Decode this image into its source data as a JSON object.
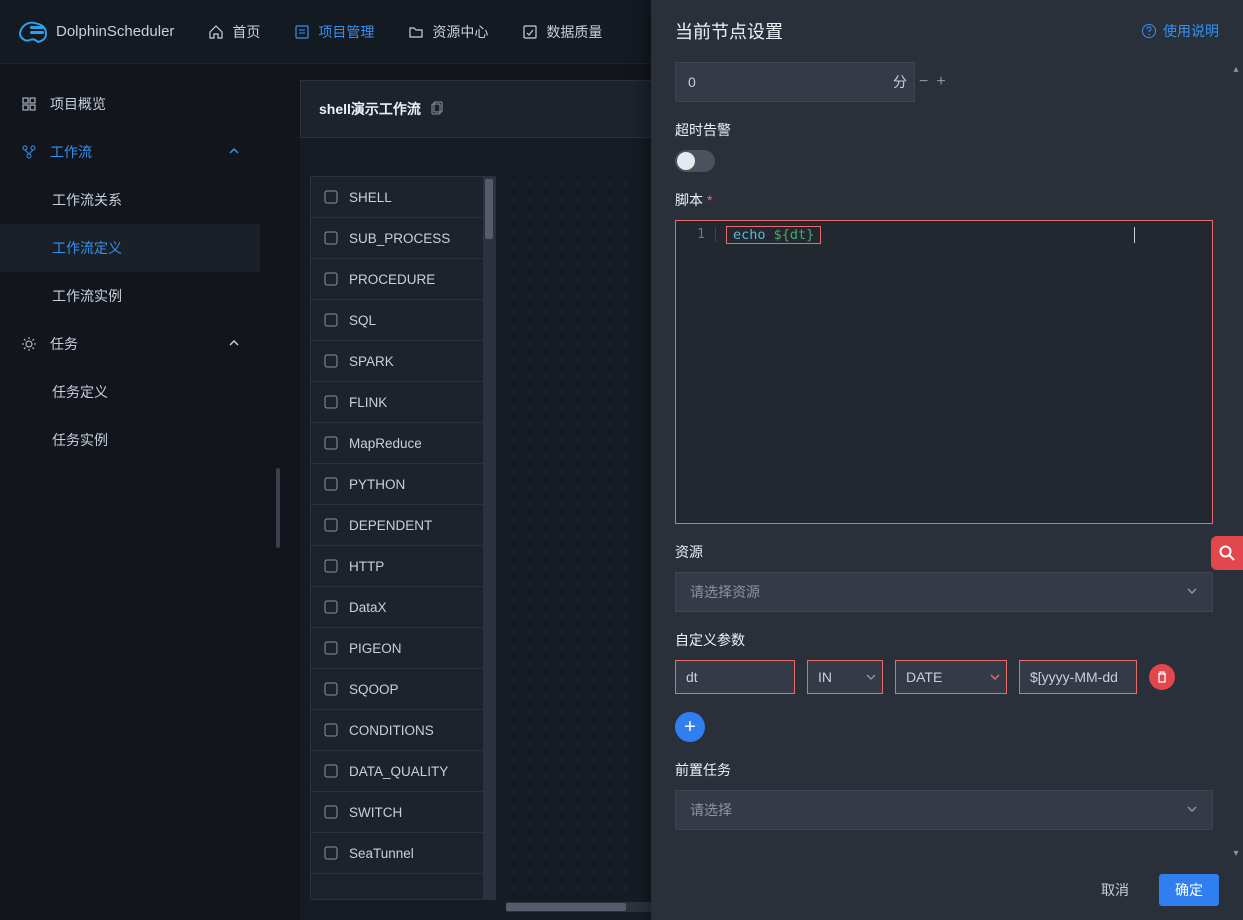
{
  "brand": "DolphinScheduler",
  "topnav": {
    "home": "首页",
    "project": "项目管理",
    "resource": "资源中心",
    "dataquality": "数据质量"
  },
  "sidebar": {
    "overview": "项目概览",
    "workflow": "工作流",
    "wf_relation": "工作流关系",
    "wf_definition": "工作流定义",
    "wf_instance": "工作流实例",
    "task": "任务",
    "task_definition": "任务定义",
    "task_instance": "任务实例"
  },
  "workflow": {
    "title": "shell演示工作流"
  },
  "taskTypes": [
    "SHELL",
    "SUB_PROCESS",
    "PROCEDURE",
    "SQL",
    "SPARK",
    "FLINK",
    "MapReduce",
    "PYTHON",
    "DEPENDENT",
    "HTTP",
    "DataX",
    "PIGEON",
    "SQOOP",
    "CONDITIONS",
    "DATA_QUALITY",
    "SWITCH",
    "SeaTunnel"
  ],
  "drawer": {
    "title": "当前节点设置",
    "help": "使用说明",
    "delay_value": "0",
    "delay_unit": "分",
    "timeout_label": "超时告警",
    "script_label": "脚本",
    "script_line_no": "1",
    "script_cmd": "echo",
    "script_var": "${dt}",
    "resource_label": "资源",
    "resource_placeholder": "请选择资源",
    "params_label": "自定义参数",
    "param_name": "dt",
    "param_dir": "IN",
    "param_type": "DATE",
    "param_value": "$[yyyy-MM-dd",
    "pre_label": "前置任务",
    "pre_placeholder": "请选择",
    "cancel": "取消",
    "confirm": "确定"
  }
}
